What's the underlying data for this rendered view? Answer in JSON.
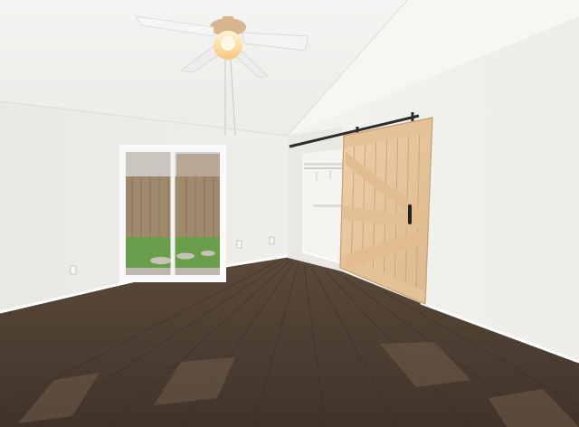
{
  "photo": {
    "palette": {
      "ceiling": "#f1f1ef",
      "left_wall": "#ecebe7",
      "right_wall": "#f2f1ed",
      "floor_dark": "#4a3c30",
      "floor_mid": "#6a5747",
      "barn_door": "#e8c8a0",
      "barn_door_frame": "#d9b386",
      "rail": "#2b2b2b",
      "grass": "#6b9e4a",
      "fence": "#a08a6e",
      "closet_wall": "#f4f3ef",
      "baseboard": "#ffffff"
    },
    "icons": [
      "ceiling-fan-icon",
      "barn-door-handle-icon",
      "outlet-icon"
    ]
  }
}
